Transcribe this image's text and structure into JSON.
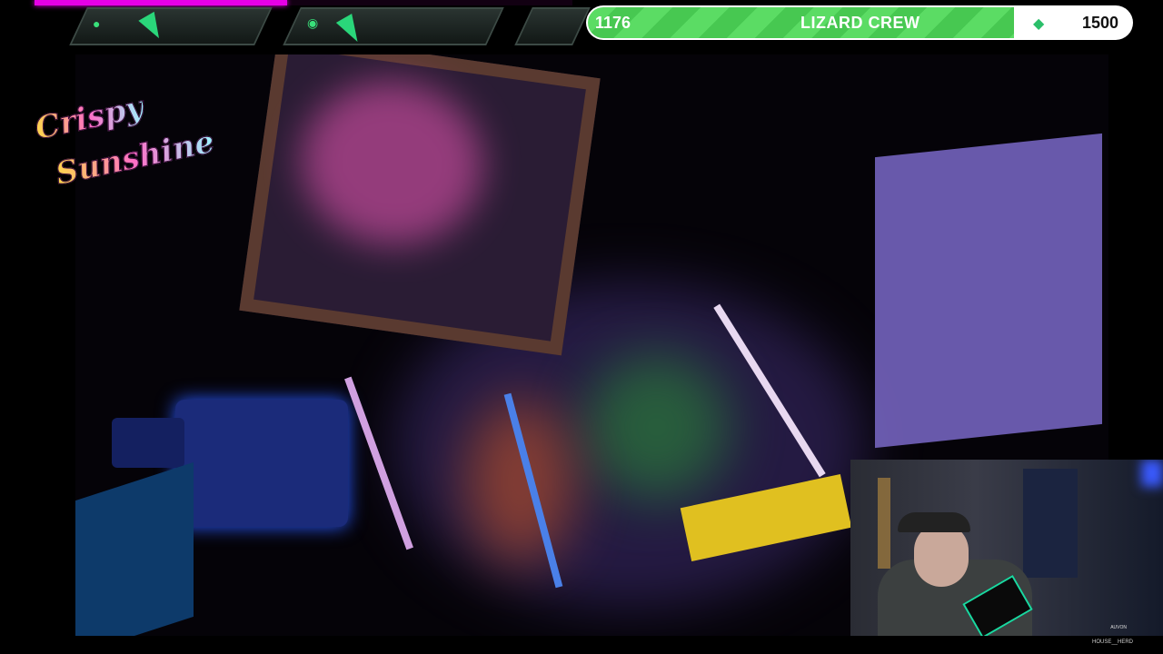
{
  "stream_bar": {
    "progress_fraction": 0.47,
    "color": "#e600e6"
  },
  "hud": {
    "left_icon": "user-icon",
    "mid_icon": "coin-icon",
    "goal": {
      "current": "1176",
      "target": "1500",
      "title": "LIZARD CREW",
      "fraction": 0.784,
      "icon": "diamond-icon",
      "fill_color": "#5bdc64"
    }
  },
  "logo": {
    "line1": "Crispy",
    "line2": "Sunshine"
  },
  "webcam": {
    "corner_label": "AUVON"
  },
  "footer": {
    "handle": "HOUSE__HERD"
  }
}
